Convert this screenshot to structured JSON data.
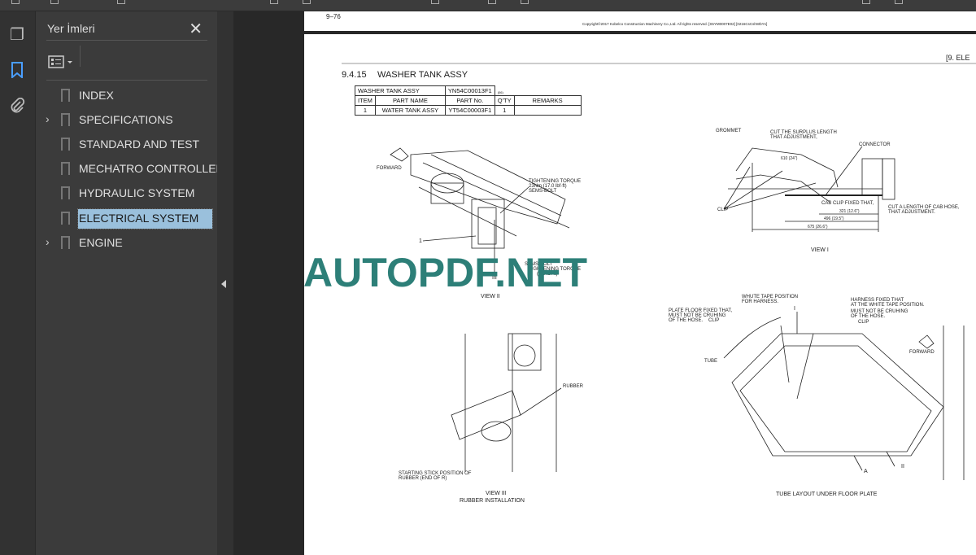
{
  "sidebar": {
    "rail_icons": [
      "pages-icon",
      "bookmark-icon",
      "paperclip-icon"
    ],
    "title": "Yer İmleri",
    "bookmarks": [
      {
        "label": "INDEX",
        "expandable": false
      },
      {
        "label": "SPECIFICATIONS",
        "expandable": true
      },
      {
        "label": "STANDARD AND TEST",
        "expandable": false
      },
      {
        "label": "MECHATRO CONTROLLER",
        "expandable": false
      },
      {
        "label": "HYDRAULIC SYSTEM",
        "expandable": false
      },
      {
        "label": "ELECTRICAL SYSTEM",
        "expandable": false,
        "selected": true
      },
      {
        "label": "ENGINE",
        "expandable": true
      }
    ],
    "selected_color": "#9ac0dc",
    "accent_color": "#4a9eff"
  },
  "document": {
    "prev_page_number": "9–76",
    "copyright": "Copyright©2017 Kobelco Construction Machinery Co.,Ltd. All rights reserved. [S5YM0007E02] [0216CsCshWbYs]",
    "chapter": "[9.  ELE",
    "section_number": "9.4.15",
    "section_title": "WASHER TANK ASSY",
    "table": {
      "assy_name": "WASHER TANK ASSY",
      "assy_no": "YN54C00013F1",
      "rev": "(06)",
      "headers": [
        "ITEM",
        "PART NAME",
        "PART No.",
        "Q'TY",
        "REMARKS"
      ],
      "rows": [
        [
          "1",
          "WATER TANK ASSY",
          "YT54C00003F1",
          "1",
          ""
        ]
      ]
    },
    "view2": {
      "forward": "FORWARD",
      "torque1": "TIGHTENING TORQUE",
      "torque1_val": "23Nm (17.0 lbf·ft)",
      "bolt1": "SEMS-BOLT",
      "item": "1",
      "bolt2": "SEMS-BOLT",
      "torque2": "TIGHTENING TORQUE",
      "torque2_val": "(8.5 lbf·ft)",
      "ref": "III",
      "caption": "VIEW II"
    },
    "view1": {
      "grommet": "GROMMET",
      "cut1": "CUT THE SURPLUS LENGTH",
      "cut1b": "THAT ADJUSTMENT,",
      "dim_top": "610 (24\")",
      "connector": "CONNECTOR",
      "clip": "CLIP",
      "cab_clip": "CAB CLIP FIXED THAT,",
      "cut2": "CUT A LENGTH OF CAB HOSE,",
      "cut2b": "THAT ADJUSTMENT.",
      "dim1": "321 (12.6\")",
      "dim2": "496 (19.5\")",
      "dim3": "675 (26.6\")",
      "caption": "VIEW I"
    },
    "view3": {
      "rubber": "RUBBER",
      "start1": "STARTING STICK POSITION OF",
      "start2": "RUBBER (END OF R)",
      "caption": "VIEW III",
      "subcaption": "RUBBER INSTALLATION"
    },
    "tube": {
      "plate1": "PLATE FLOOR FIXED THAT,",
      "plate2": "MUST NOT BE CRUHING",
      "plate3": "OF THE HOSE.",
      "clip_left": "CLIP",
      "white1": "WHUTE TAPE POSITION",
      "white2": "FOR HARNESS.",
      "harn1": "HARNESS FIXED THAT",
      "harn2": "AT THE WHITE TAPE POSITION.",
      "harn3": "MUST NOT BE CRUHING",
      "harn4": "OF THE HOSE.",
      "clip_right": "CLIP",
      "forward": "FORWARD",
      "tube": "TUBE",
      "ref_i": "I",
      "ref_a": "A",
      "ref_ii": "II",
      "caption": "TUBE LAYOUT UNDER FLOOR PLATE"
    },
    "watermark": "AUTOPDF.NET",
    "watermark_color": "#2d7f78"
  }
}
